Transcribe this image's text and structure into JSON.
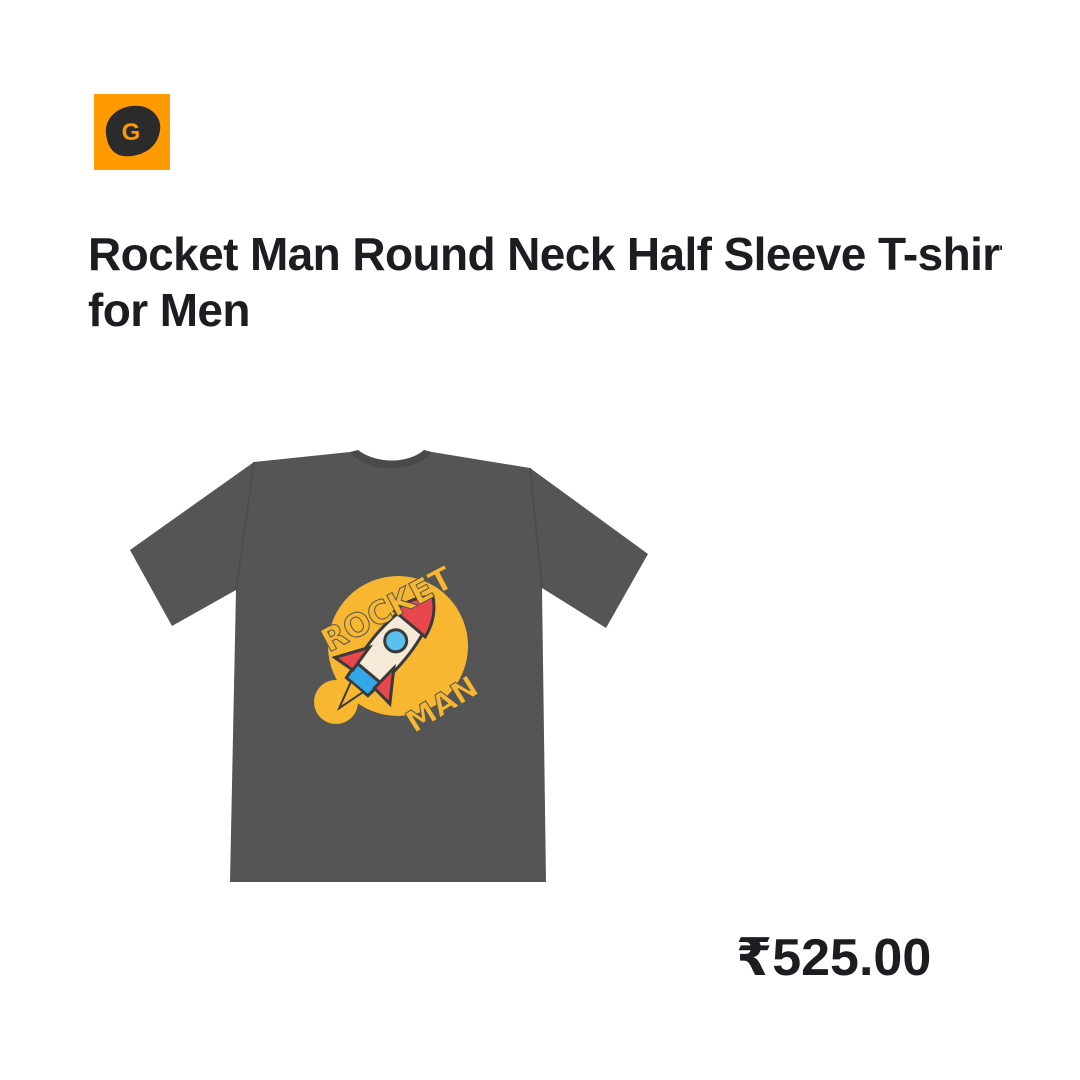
{
  "brand": {
    "logo_letter": "G",
    "logo_icon": "brand-logo-icon",
    "colors": {
      "logo_bg": "#ff9a00",
      "logo_mark": "#2b2b2b"
    }
  },
  "product": {
    "title": "Rocket Man Round Neck Half Sleeve T-shirt for Men",
    "image_icon": "tshirt-image",
    "shirt_color": "#555555",
    "print": {
      "line1": "ROCKET",
      "line2": "MAN"
    },
    "price_currency": "₹",
    "price_amount": "525.00"
  }
}
